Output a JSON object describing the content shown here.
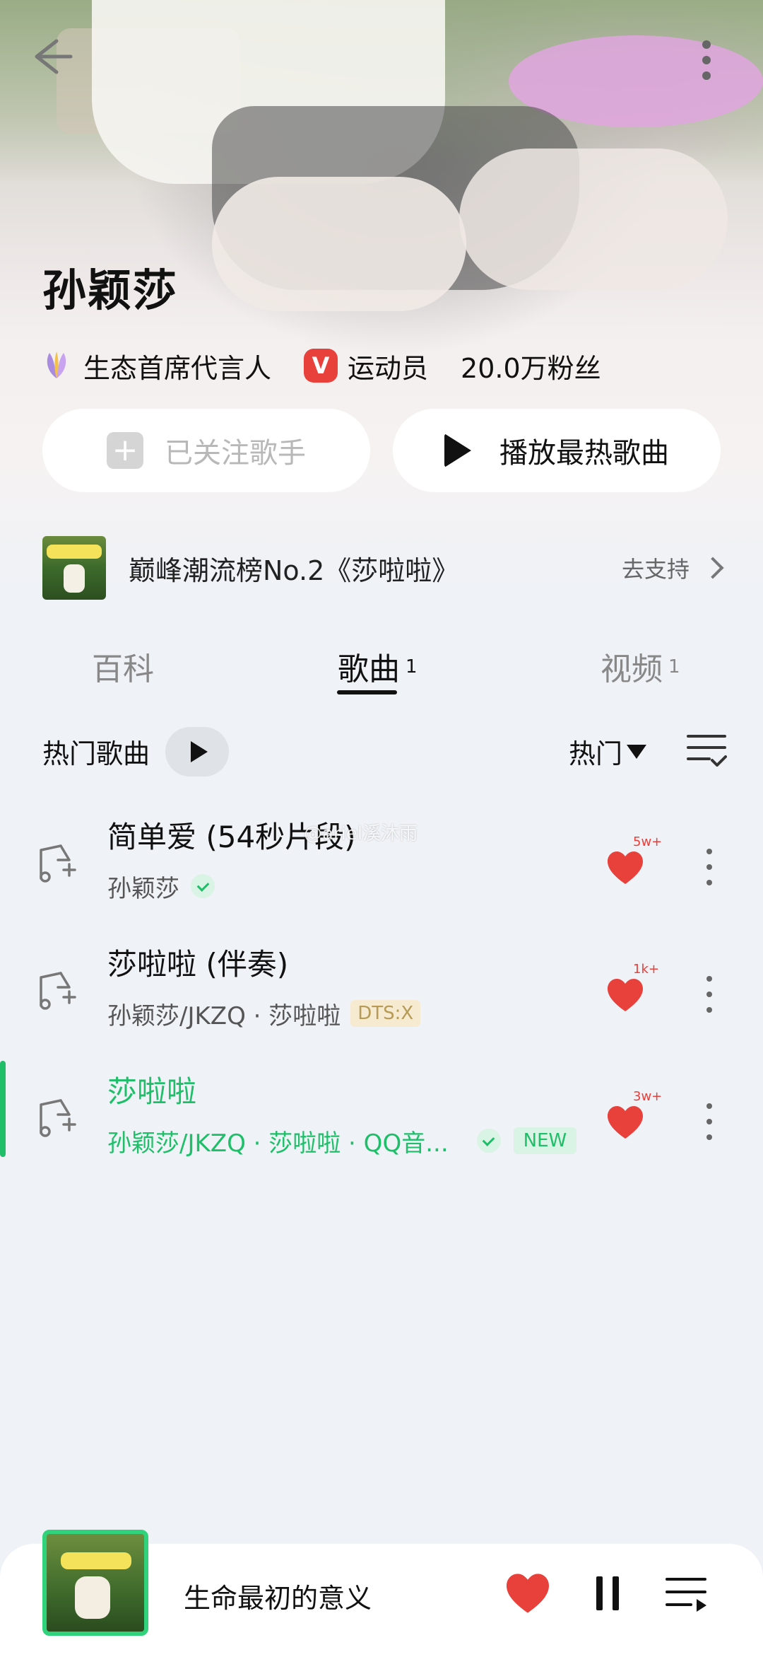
{
  "artist": {
    "name": "孙颖莎",
    "tags": [
      {
        "label": "生态首席代言人",
        "icon": "leaf-badge-icon"
      },
      {
        "label": "运动员",
        "icon": "v-badge-icon",
        "badge": "V"
      },
      {
        "label": "20.0万粉丝"
      }
    ],
    "follow_label": "已关注歌手",
    "play_hot_label": "播放最热歌曲"
  },
  "banner": {
    "text": "巅峰潮流榜No.2《莎啦啦》",
    "action": "去支持"
  },
  "tabs": [
    {
      "label": "百科",
      "count": ""
    },
    {
      "label": "歌曲",
      "count": "1"
    },
    {
      "label": "视频",
      "count": "1"
    }
  ],
  "section": {
    "title": "热门歌曲",
    "sort_label": "热门"
  },
  "songs": [
    {
      "title": "简单爱 (54秒片段)",
      "artist": "孙颖莎",
      "likes": "5w+",
      "verified": true
    },
    {
      "title": "莎啦啦 (伴奏)",
      "artist": "孙颖莎/JKZQ · 莎啦啦",
      "likes": "1k+",
      "badge": "DTS:X"
    },
    {
      "title": "莎啦啦",
      "artist": "孙颖莎/JKZQ · 莎啦啦 · QQ音...",
      "likes": "3w+",
      "verified": true,
      "badge": "NEW",
      "playing": true
    }
  ],
  "watermark": "@ariel溪沐雨",
  "player": {
    "title": "生命最初的意义"
  },
  "colors": {
    "accent_green": "#1fbf6a",
    "heart_red": "#e8413c",
    "background": "#eff2f6"
  }
}
